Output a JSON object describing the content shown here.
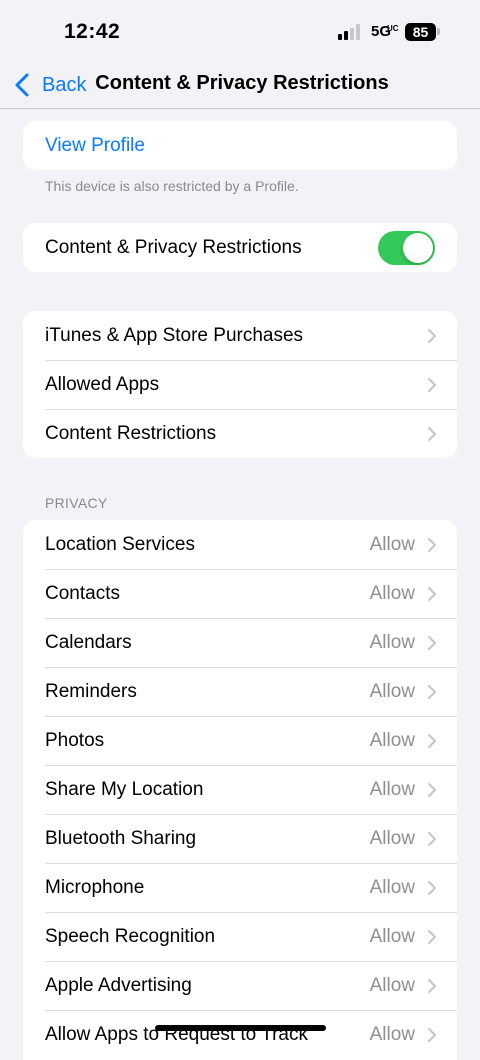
{
  "status_bar": {
    "time": "12:42",
    "network": "5G",
    "network_superscript": "UC",
    "battery": "85",
    "signal_bars_active": 2,
    "signal_bars_total": 4
  },
  "nav": {
    "back_label": "Back",
    "title": "Content & Privacy Restrictions"
  },
  "profile": {
    "view_profile_label": "View Profile",
    "footnote": "This device is also restricted by a Profile."
  },
  "restrictions_toggle": {
    "label": "Content & Privacy Restrictions",
    "on": true,
    "color": "#34c759"
  },
  "store_group": {
    "items": [
      {
        "label": "iTunes & App Store Purchases"
      },
      {
        "label": "Allowed Apps"
      },
      {
        "label": "Content Restrictions"
      }
    ]
  },
  "privacy": {
    "header": "PRIVACY",
    "items": [
      {
        "label": "Location Services",
        "value": "Allow"
      },
      {
        "label": "Contacts",
        "value": "Allow"
      },
      {
        "label": "Calendars",
        "value": "Allow"
      },
      {
        "label": "Reminders",
        "value": "Allow"
      },
      {
        "label": "Photos",
        "value": "Allow"
      },
      {
        "label": "Share My Location",
        "value": "Allow"
      },
      {
        "label": "Bluetooth Sharing",
        "value": "Allow"
      },
      {
        "label": "Microphone",
        "value": "Allow"
      },
      {
        "label": "Speech Recognition",
        "value": "Allow"
      },
      {
        "label": "Apple Advertising",
        "value": "Allow"
      },
      {
        "label": "Allow Apps to Request to Track",
        "value": "Allow"
      }
    ]
  },
  "colors": {
    "accent": "#0a7aff",
    "background": "#f2f2f7",
    "secondary_text": "#8e8e93"
  }
}
